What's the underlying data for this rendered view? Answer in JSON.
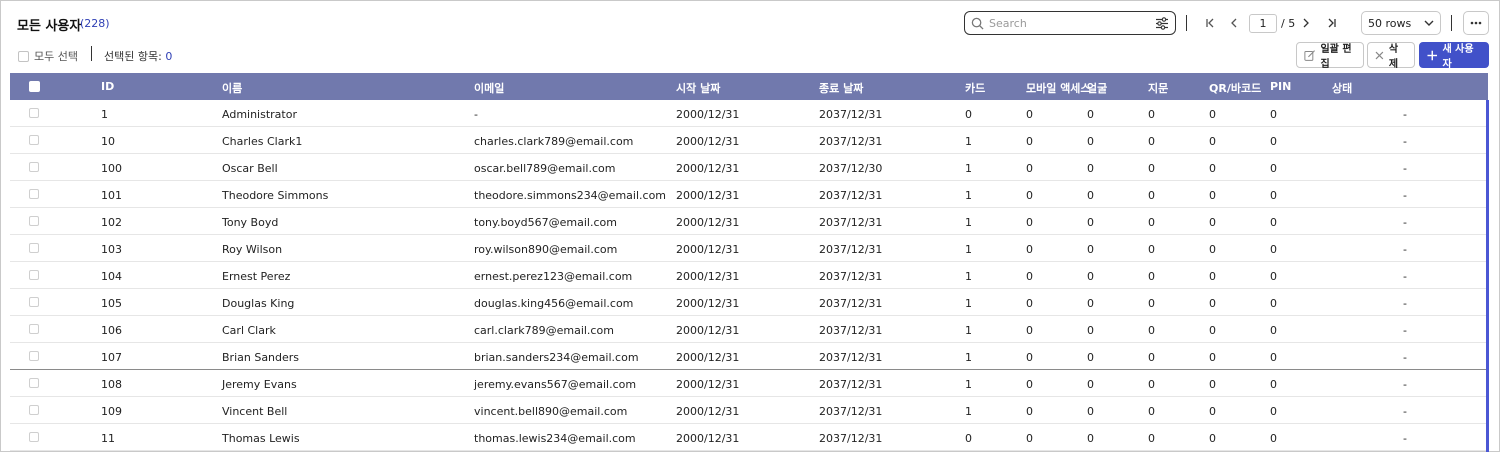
{
  "header": {
    "title": "모든 사용자",
    "count": "(228)",
    "select_all_label": "모두 선택",
    "selected_items_label": "선택된 항목: ",
    "selected_items_count": "0"
  },
  "toolbar": {
    "search_placeholder": "Search",
    "current_page": "1",
    "total_pages": "/ 5",
    "rows_per_page": "50 rows",
    "bulk_edit_label": "일괄 편집",
    "delete_label": "삭제",
    "new_user_label": "새 사용자"
  },
  "table": {
    "columns": [
      "ID",
      "이름",
      "이메일",
      "시작 날짜",
      "종료 날짜",
      "카드",
      "모바일 액세스",
      "얼굴",
      "지문",
      "QR/바코드",
      "PIN",
      "상태"
    ],
    "rows": [
      [
        "1",
        "Administrator",
        "-",
        "2000/12/31",
        "2037/12/31",
        "0",
        "0",
        "0",
        "0",
        "0",
        "0",
        "-"
      ],
      [
        "10",
        "Charles Clark1",
        "charles.clark789@email.com",
        "2000/12/31",
        "2037/12/31",
        "1",
        "0",
        "0",
        "0",
        "0",
        "0",
        "-"
      ],
      [
        "100",
        "Oscar Bell",
        "oscar.bell789@email.com",
        "2000/12/31",
        "2037/12/30",
        "1",
        "0",
        "0",
        "0",
        "0",
        "0",
        "-"
      ],
      [
        "101",
        "Theodore Simmons",
        "theodore.simmons234@email.com",
        "2000/12/31",
        "2037/12/31",
        "1",
        "0",
        "0",
        "0",
        "0",
        "0",
        "-"
      ],
      [
        "102",
        "Tony Boyd",
        "tony.boyd567@email.com",
        "2000/12/31",
        "2037/12/31",
        "1",
        "0",
        "0",
        "0",
        "0",
        "0",
        "-"
      ],
      [
        "103",
        "Roy Wilson",
        "roy.wilson890@email.com",
        "2000/12/31",
        "2037/12/31",
        "1",
        "0",
        "0",
        "0",
        "0",
        "0",
        "-"
      ],
      [
        "104",
        "Ernest Perez",
        "ernest.perez123@email.com",
        "2000/12/31",
        "2037/12/31",
        "1",
        "0",
        "0",
        "0",
        "0",
        "0",
        "-"
      ],
      [
        "105",
        "Douglas King",
        "douglas.king456@email.com",
        "2000/12/31",
        "2037/12/31",
        "1",
        "0",
        "0",
        "0",
        "0",
        "0",
        "-"
      ],
      [
        "106",
        "Carl Clark",
        "carl.clark789@email.com",
        "2000/12/31",
        "2037/12/31",
        "1",
        "0",
        "0",
        "0",
        "0",
        "0",
        "-"
      ],
      [
        "107",
        "Brian Sanders",
        "brian.sanders234@email.com",
        "2000/12/31",
        "2037/12/31",
        "1",
        "0",
        "0",
        "0",
        "0",
        "0",
        "-"
      ],
      [
        "108",
        "Jeremy Evans",
        "jeremy.evans567@email.com",
        "2000/12/31",
        "2037/12/31",
        "1",
        "0",
        "0",
        "0",
        "0",
        "0",
        "-"
      ],
      [
        "109",
        "Vincent Bell",
        "vincent.bell890@email.com",
        "2000/12/31",
        "2037/12/31",
        "1",
        "0",
        "0",
        "0",
        "0",
        "0",
        "-"
      ],
      [
        "11",
        "Thomas Lewis",
        "thomas.lewis234@email.com",
        "2000/12/31",
        "2037/12/31",
        "0",
        "0",
        "0",
        "0",
        "0",
        "0",
        "-"
      ]
    ]
  }
}
